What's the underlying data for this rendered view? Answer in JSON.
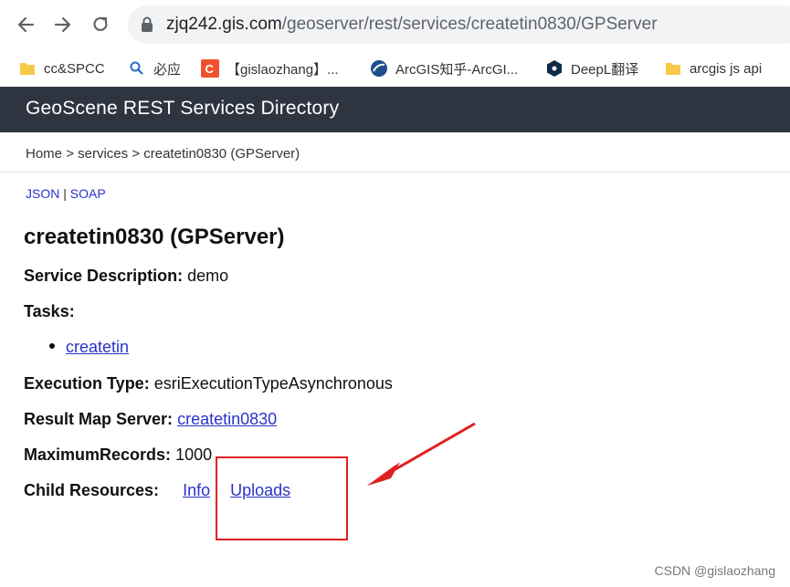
{
  "browser": {
    "url_host": "zjq242.gis.com",
    "url_path": "/geoserver/rest/services/createtin0830/GPServer",
    "bookmarks": [
      {
        "label": "cc&SPCC",
        "icon": "folder-icon"
      },
      {
        "label": "必应",
        "icon": "search-icon"
      },
      {
        "label": "【gislaozhang】...",
        "icon": "csdn-icon"
      },
      {
        "label": "ArcGIS知乎-ArcGI...",
        "icon": "arcgis-icon"
      },
      {
        "label": "DeepL翻译",
        "icon": "deepl-icon"
      },
      {
        "label": "arcgis js api",
        "icon": "folder-icon"
      }
    ]
  },
  "header": {
    "title": "GeoScene REST Services Directory"
  },
  "breadcrumb": {
    "home": "Home",
    "sep": ">",
    "services": "services",
    "current": "createtin0830 (GPServer)"
  },
  "formats": {
    "json": "JSON",
    "divider": "|",
    "soap": "SOAP"
  },
  "service": {
    "title": "createtin0830 (GPServer)",
    "description_label": "Service Description:",
    "description_value": "demo",
    "tasks_label": "Tasks:",
    "tasks": [
      "createtin"
    ],
    "execution_label": "Execution Type:",
    "execution_value": "esriExecutionTypeAsynchronous",
    "result_map_label": "Result Map Server:",
    "result_map_value": "createtin0830",
    "max_records_label": "MaximumRecords:",
    "max_records_value": "1000",
    "child_resources_label": "Child Resources:",
    "child_info": "Info",
    "child_uploads": "Uploads"
  },
  "annotation": {
    "highlight_color": "#e02020"
  },
  "watermark": "CSDN @gislaozhang"
}
